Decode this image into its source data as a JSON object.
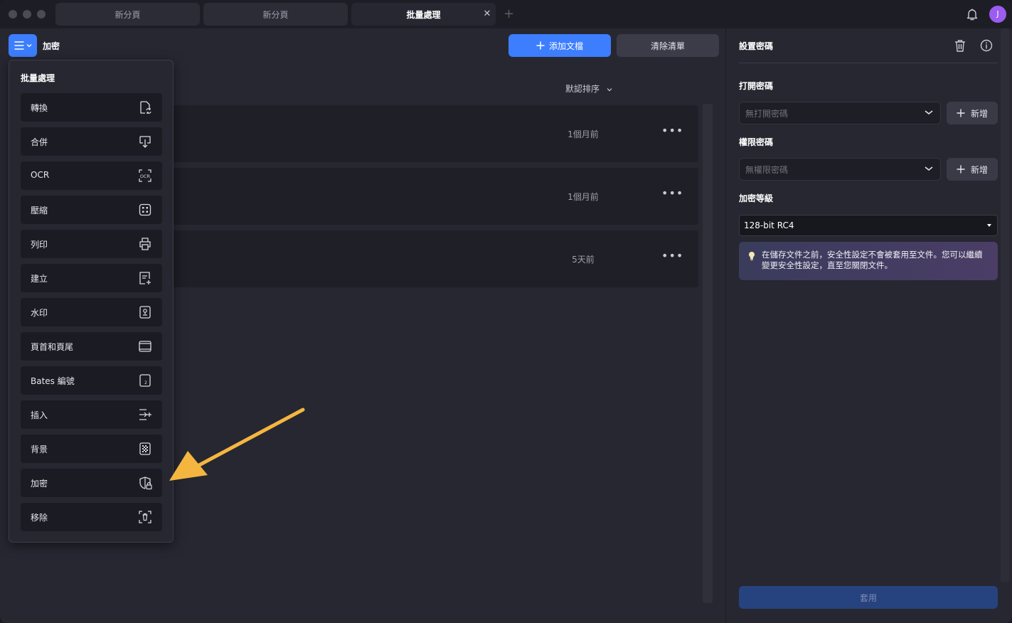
{
  "tabs": [
    {
      "label": "新分頁"
    },
    {
      "label": "新分頁"
    },
    {
      "label": "批量處理"
    }
  ],
  "user": {
    "avatar_initial": "J"
  },
  "toolbar": {
    "title": "加密",
    "add_files_label": "添加文檔",
    "clear_list_label": "清除清單",
    "sort_label": "默認排序"
  },
  "files": [
    {
      "time": "1個月前"
    },
    {
      "time": "1個月前"
    },
    {
      "time": "5天前"
    }
  ],
  "dropdown": {
    "title": "批量處理",
    "items": [
      {
        "label": "轉換",
        "icon": "convert-icon"
      },
      {
        "label": "合併",
        "icon": "merge-icon"
      },
      {
        "label": "OCR",
        "icon": "ocr-icon"
      },
      {
        "label": "壓縮",
        "icon": "compress-icon"
      },
      {
        "label": "列印",
        "icon": "print-icon"
      },
      {
        "label": "建立",
        "icon": "create-icon"
      },
      {
        "label": "水印",
        "icon": "watermark-icon"
      },
      {
        "label": "頁首和頁尾",
        "icon": "header-footer-icon"
      },
      {
        "label": "Bates 編號",
        "icon": "bates-number-icon"
      },
      {
        "label": "插入",
        "icon": "insert-icon"
      },
      {
        "label": "背景",
        "icon": "background-icon"
      },
      {
        "label": "加密",
        "icon": "encrypt-icon"
      },
      {
        "label": "移除",
        "icon": "remove-icon"
      }
    ]
  },
  "right_panel": {
    "title": "設置密碼",
    "open_password_label": "打開密碼",
    "open_password_value": "無打開密碼",
    "permission_password_label": "權限密碼",
    "permission_password_value": "無權限密碼",
    "new_label": "新增",
    "encryption_level_label": "加密等級",
    "encryption_level_value": "128-bit RC4",
    "note": "在儲存文件之前，安全性設定不會被套用至文件。您可以繼續變更安全性設定，直至您關閉文件。",
    "apply_label": "套用"
  },
  "colors": {
    "accent": "#3d7eff",
    "annotation_arrow": "#f5b640",
    "avatar": "#9b5cf0"
  }
}
